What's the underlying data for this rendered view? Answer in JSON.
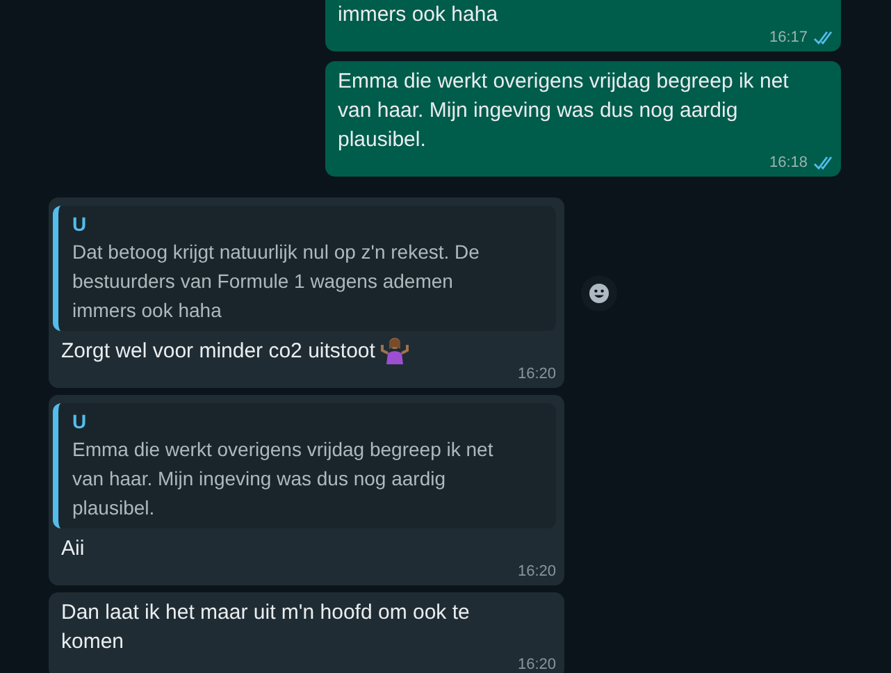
{
  "messages": [
    {
      "kind": "outgoing",
      "cut_top": true,
      "text": "immers ook haha",
      "time": "16:17",
      "read": true
    },
    {
      "kind": "outgoing",
      "cut_top": false,
      "text": "Emma die werkt overigens vrijdag begreep ik net van haar. Mijn ingeving was dus nog aardig plausibel.",
      "time": "16:18",
      "read": true
    },
    {
      "kind": "incoming",
      "quote": {
        "author": "U",
        "text": "Dat betoog krijgt natuurlijk nul op z'n rekest. De bestuurders van Formule 1 wagens ademen immers ook haha"
      },
      "text": "Zorgt wel voor minder co2 uitstoot",
      "emoji": true,
      "time": "16:20",
      "reaction_button": true
    },
    {
      "kind": "incoming",
      "quote": {
        "author": "U",
        "text": "Emma die werkt overigens vrijdag begreep ik net van haar. Mijn ingeving was dus nog aardig plausibel."
      },
      "text": "Aii",
      "time": "16:20",
      "reaction_button": false
    },
    {
      "kind": "incoming",
      "text": "Dan laat ik het maar uit m'n hoofd om ook te komen",
      "time": "16:20",
      "reaction_button": false
    }
  ]
}
